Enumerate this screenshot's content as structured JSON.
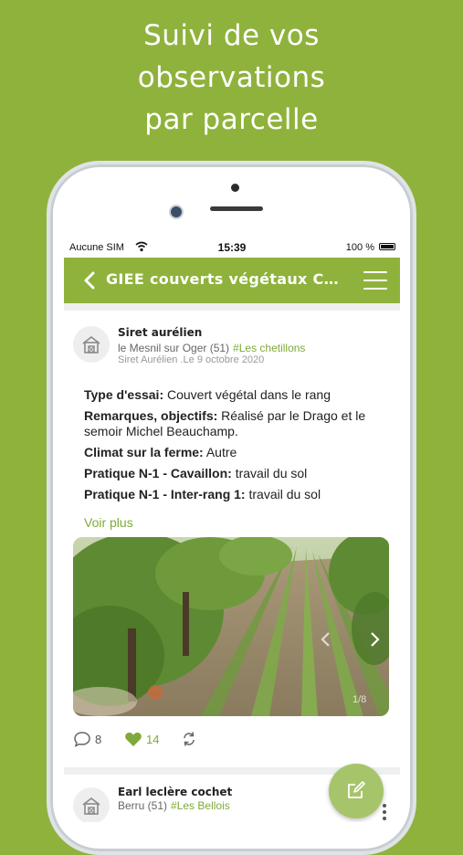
{
  "headline": {
    "line1": "Suivi de vos",
    "line2": "observations",
    "line3": "par parcelle"
  },
  "statusbar": {
    "carrier": "Aucune SIM",
    "time": "15:39",
    "battery": "100 %"
  },
  "appbar": {
    "title": "GIEE couverts végétaux Ch…"
  },
  "post": {
    "author": "Siret aurélien",
    "location": "le Mesnil sur Oger (51)",
    "tag": "#Les chetillons",
    "byline": "Siret Aurélien .Le 9 octobre 2020",
    "fields": [
      {
        "label": "Type d'essai:",
        "value": " Couvert végétal dans le rang"
      },
      {
        "label": "Remarques, objectifs:",
        "value": " Réalisé par le Drago et le semoir Michel Beauchamp."
      },
      {
        "label": "Climat sur la ferme:",
        "value": " Autre"
      },
      {
        "label": "Pratique N-1 - Cavaillon:",
        "value": " travail du sol"
      },
      {
        "label": "Pratique N-1 - Inter-rang 1:",
        "value": " travail du sol"
      }
    ],
    "see_more": "Voir plus",
    "photo_counter": "1/8",
    "comments_count": "8",
    "likes_count": "14"
  },
  "post2": {
    "author": "Earl leclère cochet",
    "location": "Berru (51)",
    "tag": "#Les Bellois"
  },
  "colors": {
    "brand_green": "#8fb23c",
    "tag_green": "#7fa93a",
    "fab_green": "#a6c56a"
  }
}
